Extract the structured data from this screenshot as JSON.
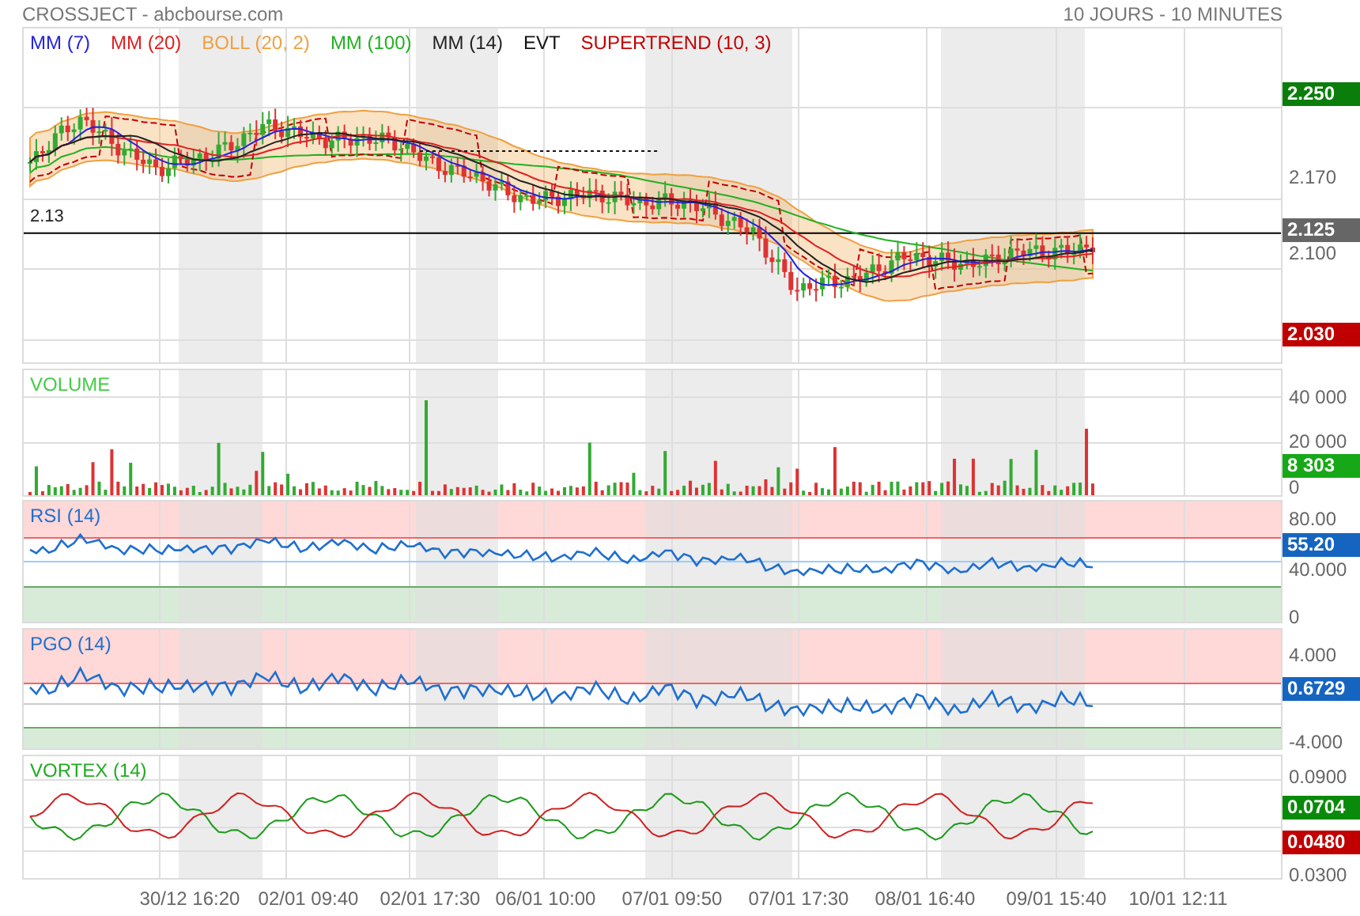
{
  "header": {
    "title": "CROSSJECT - abcbourse.com",
    "period": "10 JOURS - 10 MINUTES"
  },
  "legend": [
    {
      "label": "MM (7)",
      "color": "#2222dd"
    },
    {
      "label": "MM (20)",
      "color": "#e02020"
    },
    {
      "label": "BOLL (20, 2)",
      "color": "#f0a040"
    },
    {
      "label": "MM (100)",
      "color": "#22b022"
    },
    {
      "label": "MM (14)",
      "color": "#222222"
    },
    {
      "label": "EVT",
      "color": "#111111"
    },
    {
      "label": "SUPERTREND (10, 3)",
      "color": "#c00000"
    }
  ],
  "panels": [
    {
      "kind": "price",
      "line_label": "2.13",
      "axis": [
        {
          "kind": "badge",
          "text": "2.250",
          "color": "#0a7d0a"
        },
        {
          "kind": "tick",
          "text": "2.170"
        },
        {
          "kind": "badge",
          "text": "2.125",
          "color": "#666666"
        },
        {
          "kind": "tick",
          "text": "2.100"
        },
        {
          "kind": "badge",
          "text": "2.030",
          "color": "#c00000"
        }
      ]
    },
    {
      "kind": "volume",
      "title": "VOLUME",
      "axis": [
        {
          "kind": "tick",
          "text": "40 000"
        },
        {
          "kind": "tick",
          "text": "20 000"
        },
        {
          "kind": "badge",
          "text": "8 303",
          "color": "#17a817"
        },
        {
          "kind": "tick",
          "text": "0"
        }
      ]
    },
    {
      "kind": "rsi",
      "title": "RSI (14)",
      "axis": [
        {
          "kind": "tick",
          "text": "80.00"
        },
        {
          "kind": "badge",
          "text": "55.20",
          "color": "#1565c0"
        },
        {
          "kind": "tick",
          "text": "40.000"
        },
        {
          "kind": "tick",
          "text": "0"
        }
      ]
    },
    {
      "kind": "pgo",
      "title": "PGO (14)",
      "axis": [
        {
          "kind": "tick",
          "text": "4.000"
        },
        {
          "kind": "badge",
          "text": "0.6729",
          "color": "#1565c0"
        },
        {
          "kind": "tick",
          "text": "-4.000"
        }
      ]
    },
    {
      "kind": "vortex",
      "title": "VORTEX (14)",
      "axis": [
        {
          "kind": "tick",
          "text": "0.0900"
        },
        {
          "kind": "badge",
          "text": "0.0704",
          "color": "#0a8a0a"
        },
        {
          "kind": "badge",
          "text": "0.0480",
          "color": "#c00000"
        },
        {
          "kind": "tick",
          "text": "0.0300"
        }
      ]
    }
  ],
  "x_labels": [
    "30/12 16:20",
    "02/01 09:40",
    "02/01 17:30",
    "06/01 10:00",
    "07/01 09:50",
    "07/01 17:30",
    "08/01 16:40",
    "09/01 15:40",
    "10/01 12:11"
  ]
}
